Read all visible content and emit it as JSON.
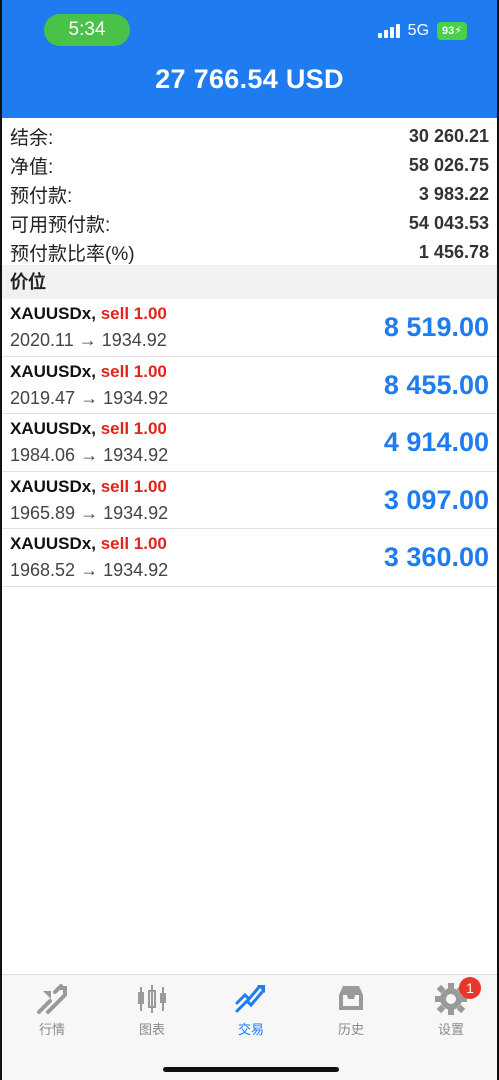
{
  "status": {
    "time": "5:34",
    "network": "5G",
    "battery": "93"
  },
  "header": {
    "title": "27 766.54 USD"
  },
  "summary": [
    {
      "label": "结余:",
      "value": "30 260.21"
    },
    {
      "label": "净值:",
      "value": "58 026.75"
    },
    {
      "label": "预付款:",
      "value": "3 983.22"
    },
    {
      "label": "可用预付款:",
      "value": "54 043.53"
    },
    {
      "label": "预付款比率(%)",
      "value": "1 456.78"
    }
  ],
  "section_title": "价位",
  "positions": [
    {
      "symbol": "XAUUSDx,",
      "side": "sell 1.00",
      "prices": "2020.11 → 1934.92",
      "profit": "8 519.00"
    },
    {
      "symbol": "XAUUSDx,",
      "side": "sell 1.00",
      "prices": "2019.47 → 1934.92",
      "profit": "8 455.00"
    },
    {
      "symbol": "XAUUSDx,",
      "side": "sell 1.00",
      "prices": "1984.06 → 1934.92",
      "profit": "4 914.00"
    },
    {
      "symbol": "XAUUSDx,",
      "side": "sell 1.00",
      "prices": "1965.89 → 1934.92",
      "profit": "3 097.00"
    },
    {
      "symbol": "XAUUSDx,",
      "side": "sell 1.00",
      "prices": "1968.52 → 1934.92",
      "profit": "3 360.00"
    }
  ],
  "tabs": [
    {
      "label": "行情",
      "icon": "quotes-icon",
      "active": false
    },
    {
      "label": "图表",
      "icon": "chart-icon",
      "active": false
    },
    {
      "label": "交易",
      "icon": "trade-icon",
      "active": true
    },
    {
      "label": "历史",
      "icon": "history-icon",
      "active": false
    },
    {
      "label": "设置",
      "icon": "settings-icon",
      "active": false,
      "badge": "1"
    }
  ],
  "colors": {
    "accent": "#1e7cf0",
    "sell": "#e0241b",
    "status_green": "#4ac24a"
  }
}
